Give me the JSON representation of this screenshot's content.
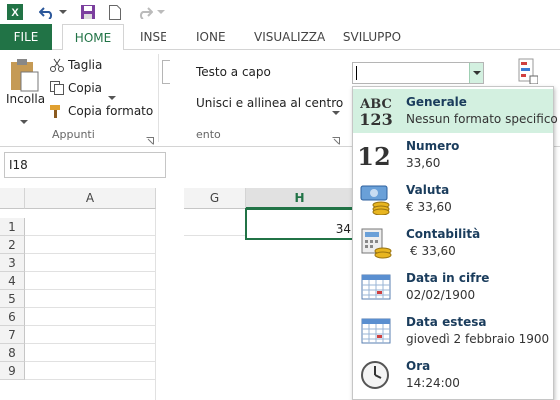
{
  "tabs": {
    "file": "FILE",
    "home": "HOME",
    "insert_partial": "INSER",
    "formulas_partial": "IONE",
    "view": "VISUALIZZA",
    "developer": "SVILUPPO"
  },
  "clipboard": {
    "paste": "Incolla",
    "cut": "Taglia",
    "copy": "Copia",
    "format_painter": "Copia formato",
    "group_label": "Appunti"
  },
  "alignment": {
    "wrap_text": "Testo a capo",
    "merge_center": "Unisci e allinea al centro",
    "group_label_partial": "ento"
  },
  "name_box": {
    "value": "I18"
  },
  "columns": [
    "A",
    "G",
    "H"
  ],
  "rows": [
    "1",
    "2",
    "3",
    "4",
    "5",
    "6",
    "7",
    "8",
    "9"
  ],
  "cell_h1_partial": "34",
  "number_format": {
    "value": "",
    "options": [
      {
        "title": "Generale",
        "sub": "Nessun formato specifico",
        "icon": "abc-123-icon",
        "glyph_top": "ABC",
        "glyph_bottom": "123"
      },
      {
        "title": "Numero",
        "sub": "33,60",
        "icon": "number-12-icon",
        "glyph": "12"
      },
      {
        "title": "Valuta",
        "sub": "€ 33,60",
        "icon": "currency-icon"
      },
      {
        "title": "Contabilità",
        "sub": "€ 33,60",
        "icon": "accounting-icon"
      },
      {
        "title": "Data in cifre",
        "sub": "02/02/1900",
        "icon": "short-date-calendar-icon"
      },
      {
        "title": "Data estesa",
        "sub": "giovedì 2 febbraio 1900",
        "icon": "long-date-calendar-icon"
      },
      {
        "title": "Ora",
        "sub": "14:24:00",
        "icon": "clock-icon"
      }
    ]
  },
  "colors": {
    "excel_green": "#217346",
    "selection": "#d3f0e0"
  }
}
